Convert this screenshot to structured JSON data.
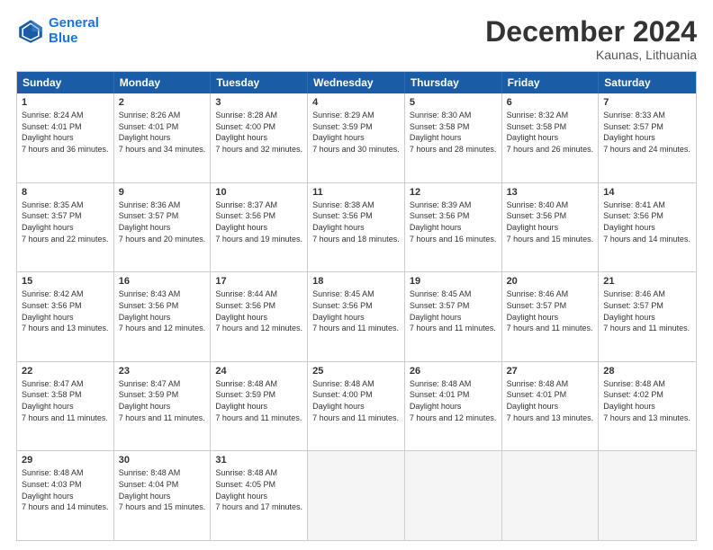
{
  "header": {
    "logo_line1": "General",
    "logo_line2": "Blue",
    "month": "December 2024",
    "location": "Kaunas, Lithuania"
  },
  "days": [
    "Sunday",
    "Monday",
    "Tuesday",
    "Wednesday",
    "Thursday",
    "Friday",
    "Saturday"
  ],
  "weeks": [
    [
      {
        "day": "1",
        "sunrise": "8:24 AM",
        "sunset": "4:01 PM",
        "daylight": "7 hours and 36 minutes."
      },
      {
        "day": "2",
        "sunrise": "8:26 AM",
        "sunset": "4:01 PM",
        "daylight": "7 hours and 34 minutes."
      },
      {
        "day": "3",
        "sunrise": "8:28 AM",
        "sunset": "4:00 PM",
        "daylight": "7 hours and 32 minutes."
      },
      {
        "day": "4",
        "sunrise": "8:29 AM",
        "sunset": "3:59 PM",
        "daylight": "7 hours and 30 minutes."
      },
      {
        "day": "5",
        "sunrise": "8:30 AM",
        "sunset": "3:58 PM",
        "daylight": "7 hours and 28 minutes."
      },
      {
        "day": "6",
        "sunrise": "8:32 AM",
        "sunset": "3:58 PM",
        "daylight": "7 hours and 26 minutes."
      },
      {
        "day": "7",
        "sunrise": "8:33 AM",
        "sunset": "3:57 PM",
        "daylight": "7 hours and 24 minutes."
      }
    ],
    [
      {
        "day": "8",
        "sunrise": "8:35 AM",
        "sunset": "3:57 PM",
        "daylight": "7 hours and 22 minutes."
      },
      {
        "day": "9",
        "sunrise": "8:36 AM",
        "sunset": "3:57 PM",
        "daylight": "7 hours and 20 minutes."
      },
      {
        "day": "10",
        "sunrise": "8:37 AM",
        "sunset": "3:56 PM",
        "daylight": "7 hours and 19 minutes."
      },
      {
        "day": "11",
        "sunrise": "8:38 AM",
        "sunset": "3:56 PM",
        "daylight": "7 hours and 18 minutes."
      },
      {
        "day": "12",
        "sunrise": "8:39 AM",
        "sunset": "3:56 PM",
        "daylight": "7 hours and 16 minutes."
      },
      {
        "day": "13",
        "sunrise": "8:40 AM",
        "sunset": "3:56 PM",
        "daylight": "7 hours and 15 minutes."
      },
      {
        "day": "14",
        "sunrise": "8:41 AM",
        "sunset": "3:56 PM",
        "daylight": "7 hours and 14 minutes."
      }
    ],
    [
      {
        "day": "15",
        "sunrise": "8:42 AM",
        "sunset": "3:56 PM",
        "daylight": "7 hours and 13 minutes."
      },
      {
        "day": "16",
        "sunrise": "8:43 AM",
        "sunset": "3:56 PM",
        "daylight": "7 hours and 12 minutes."
      },
      {
        "day": "17",
        "sunrise": "8:44 AM",
        "sunset": "3:56 PM",
        "daylight": "7 hours and 12 minutes."
      },
      {
        "day": "18",
        "sunrise": "8:45 AM",
        "sunset": "3:56 PM",
        "daylight": "7 hours and 11 minutes."
      },
      {
        "day": "19",
        "sunrise": "8:45 AM",
        "sunset": "3:57 PM",
        "daylight": "7 hours and 11 minutes."
      },
      {
        "day": "20",
        "sunrise": "8:46 AM",
        "sunset": "3:57 PM",
        "daylight": "7 hours and 11 minutes."
      },
      {
        "day": "21",
        "sunrise": "8:46 AM",
        "sunset": "3:57 PM",
        "daylight": "7 hours and 11 minutes."
      }
    ],
    [
      {
        "day": "22",
        "sunrise": "8:47 AM",
        "sunset": "3:58 PM",
        "daylight": "7 hours and 11 minutes."
      },
      {
        "day": "23",
        "sunrise": "8:47 AM",
        "sunset": "3:59 PM",
        "daylight": "7 hours and 11 minutes."
      },
      {
        "day": "24",
        "sunrise": "8:48 AM",
        "sunset": "3:59 PM",
        "daylight": "7 hours and 11 minutes."
      },
      {
        "day": "25",
        "sunrise": "8:48 AM",
        "sunset": "4:00 PM",
        "daylight": "7 hours and 11 minutes."
      },
      {
        "day": "26",
        "sunrise": "8:48 AM",
        "sunset": "4:01 PM",
        "daylight": "7 hours and 12 minutes."
      },
      {
        "day": "27",
        "sunrise": "8:48 AM",
        "sunset": "4:01 PM",
        "daylight": "7 hours and 13 minutes."
      },
      {
        "day": "28",
        "sunrise": "8:48 AM",
        "sunset": "4:02 PM",
        "daylight": "7 hours and 13 minutes."
      }
    ],
    [
      {
        "day": "29",
        "sunrise": "8:48 AM",
        "sunset": "4:03 PM",
        "daylight": "7 hours and 14 minutes."
      },
      {
        "day": "30",
        "sunrise": "8:48 AM",
        "sunset": "4:04 PM",
        "daylight": "7 hours and 15 minutes."
      },
      {
        "day": "31",
        "sunrise": "8:48 AM",
        "sunset": "4:05 PM",
        "daylight": "7 hours and 17 minutes."
      },
      null,
      null,
      null,
      null
    ]
  ]
}
